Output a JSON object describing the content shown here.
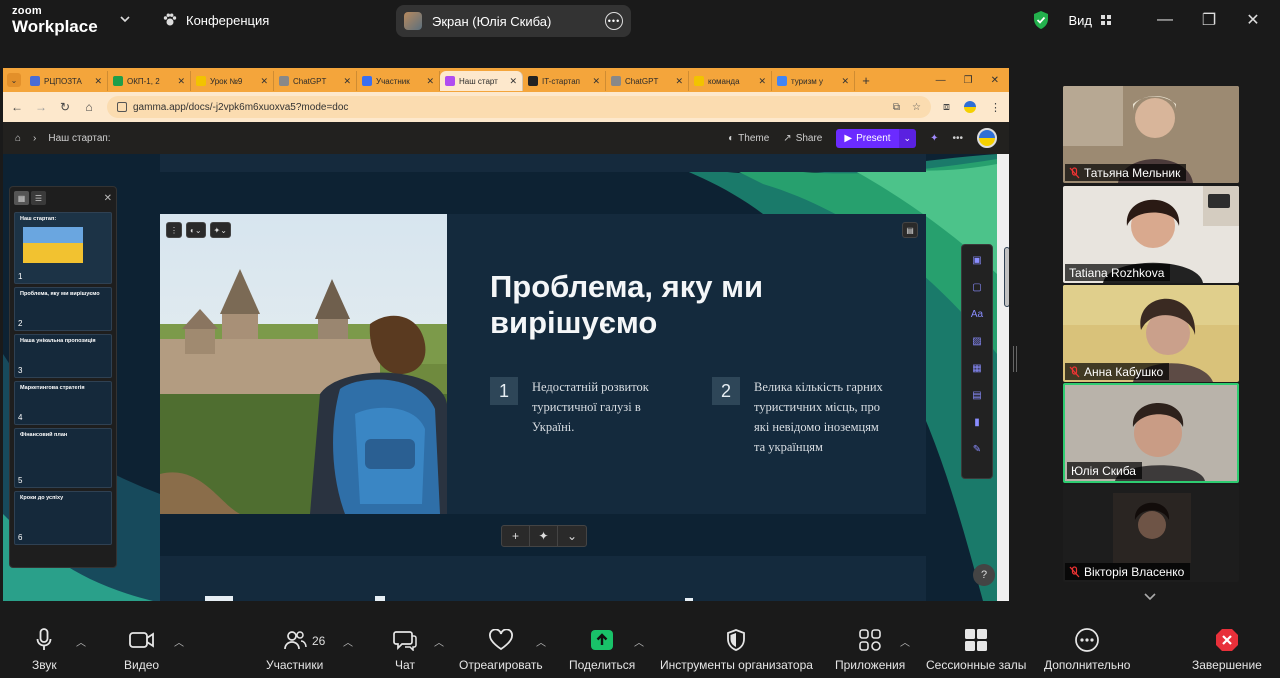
{
  "zoom": {
    "logo_line1": "zoom",
    "logo_line2": "Workplace",
    "meeting_label": "Конференция",
    "screen_share_label": "Экран (Юлія Скиба)",
    "view_label": "Вид"
  },
  "browser": {
    "tabs": [
      {
        "label": "РЦПОЗТА",
        "color": "#4a6cd4"
      },
      {
        "label": "ОКП-1, 2",
        "color": "#1e9e4a"
      },
      {
        "label": "Урок №9",
        "color": "#f2c300"
      },
      {
        "label": "ChatGPT",
        "color": "#888888"
      },
      {
        "label": "Участник",
        "color": "#3a6ff0"
      },
      {
        "label": "Наш старт",
        "color": "#b04cf0"
      },
      {
        "label": "IT-стартап",
        "color": "#222222"
      },
      {
        "label": "ChatGPT",
        "color": "#888888"
      },
      {
        "label": "команда",
        "color": "#f2c300"
      },
      {
        "label": "туризм у",
        "color": "#4285f4"
      }
    ],
    "url": "gamma.app/docs/-j2vpk6m6xuoxva5?mode=doc",
    "breadcrumb": "Наш стартап:",
    "theme_label": "Theme",
    "share_label": "Share",
    "present_label": "Present"
  },
  "slide": {
    "title": "Проблема, яку ми вирішуємо",
    "points": [
      {
        "num": "1",
        "text": "Недостатній розвиток туристичної галузі в Україні."
      },
      {
        "num": "2",
        "text": "Велика кількість гарних туристичних місць, про які невідомо іноземцям та українцям"
      }
    ]
  },
  "thumbnails": [
    {
      "num": "1",
      "title": "Наш стартап:"
    },
    {
      "num": "2",
      "title": "Проблема, яку ми вирішуємо"
    },
    {
      "num": "3",
      "title": "Наша унікальна пропозиція"
    },
    {
      "num": "4",
      "title": "Маркетингова стратегія"
    },
    {
      "num": "5",
      "title": "Фінансовий план"
    },
    {
      "num": "6",
      "title": "Кроки до успіху"
    }
  ],
  "participants": [
    {
      "name": "Татьяна Мельник",
      "muted": true
    },
    {
      "name": "Tatiana Rozhkova",
      "muted": false
    },
    {
      "name": "Анна Кабушко",
      "muted": true
    },
    {
      "name": "Юлія Скиба",
      "muted": false
    },
    {
      "name": "Вікторія Власенко",
      "muted": true
    }
  ],
  "toolbar": {
    "audio": "Звук",
    "video": "Видео",
    "participants": "Участники",
    "participants_count": "26",
    "chat": "Чат",
    "react": "Отреагировать",
    "share": "Поделиться",
    "host_tools": "Инструменты организатора",
    "apps": "Приложения",
    "breakout": "Сессионные залы",
    "more": "Дополнительно",
    "end": "Завершение"
  }
}
